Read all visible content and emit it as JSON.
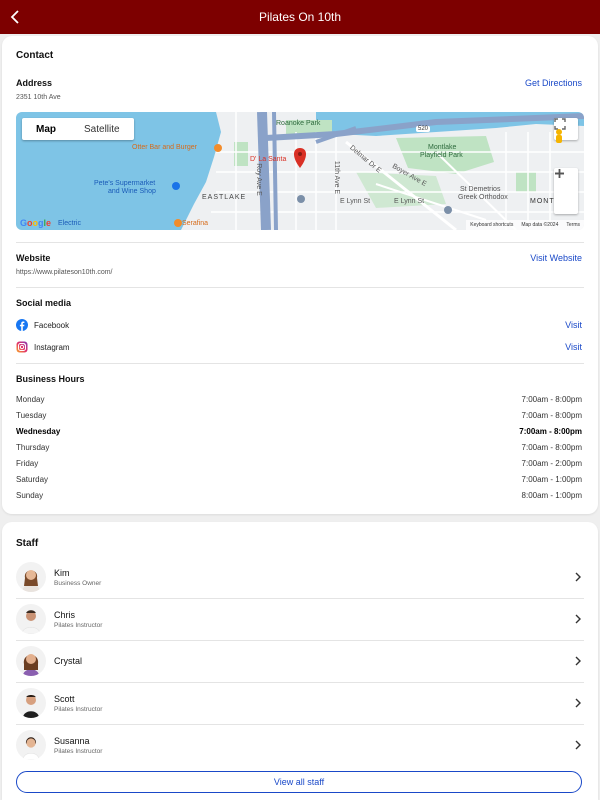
{
  "header": {
    "title": "Pilates On 10th"
  },
  "contact": {
    "section_title": "Contact",
    "address_label": "Address",
    "address": "2351 10th Ave",
    "directions_label": "Get Directions",
    "map": {
      "toggle_map": "Map",
      "toggle_satellite": "Satellite",
      "labels": {
        "roanoke": "Roanoke Park",
        "otter": "Otter Bar and Burger",
        "dla": "D' La Santa",
        "petes1": "Pete's Supermarket",
        "petes2": "and Wine Shop",
        "eastlake": "EASTLAKE",
        "montlake1": "Montlake",
        "montlake2": "Playfield Park",
        "stdem1": "St Demetrios",
        "stdem2": "Greek Orthodox",
        "serafina": "Serafina",
        "boyer": "Boyer Ave E",
        "lynn1": "E Lynn St",
        "lynn2": "E Lynn St",
        "eleventh": "11th Ave E",
        "delmar": "Delmar Dr E",
        "roy": "Roy Ave E",
        "monta": "MONTA",
        "electric": "Electric",
        "shield": "520"
      },
      "google": "Google",
      "footer_shortcuts": "Keyboard shortcuts",
      "footer_data": "Map data ©2024",
      "footer_terms": "Terms"
    },
    "website_label": "Website",
    "website_url": "https://www.pilateson10th.com/",
    "visit_website": "Visit Website",
    "social_label": "Social media",
    "social": [
      {
        "name": "Facebook",
        "action": "Visit"
      },
      {
        "name": "Instagram",
        "action": "Visit"
      }
    ],
    "hours_label": "Business Hours",
    "hours": [
      {
        "day": "Monday",
        "time": "7:00am - 8:00pm"
      },
      {
        "day": "Tuesday",
        "time": "7:00am - 8:00pm"
      },
      {
        "day": "Wednesday",
        "time": "7:00am - 8:00pm"
      },
      {
        "day": "Thursday",
        "time": "7:00am - 8:00pm"
      },
      {
        "day": "Friday",
        "time": "7:00am - 2:00pm"
      },
      {
        "day": "Saturday",
        "time": "7:00am - 1:00pm"
      },
      {
        "day": "Sunday",
        "time": "8:00am - 1:00pm"
      }
    ]
  },
  "staff": {
    "section_title": "Staff",
    "members": [
      {
        "name": "Kim",
        "role": "Business Owner"
      },
      {
        "name": "Chris",
        "role": "Pilates Instructor"
      },
      {
        "name": "Crystal",
        "role": ""
      },
      {
        "name": "Scott",
        "role": "Pilates Instructor"
      },
      {
        "name": "Susanna",
        "role": "Pilates Instructor"
      }
    ],
    "view_all": "View all staff"
  },
  "colors": {
    "header": "#7d0000",
    "link": "#1a49c8",
    "water": "#7ec4e6",
    "park": "#bfe3c3",
    "pin": "#d93025"
  }
}
